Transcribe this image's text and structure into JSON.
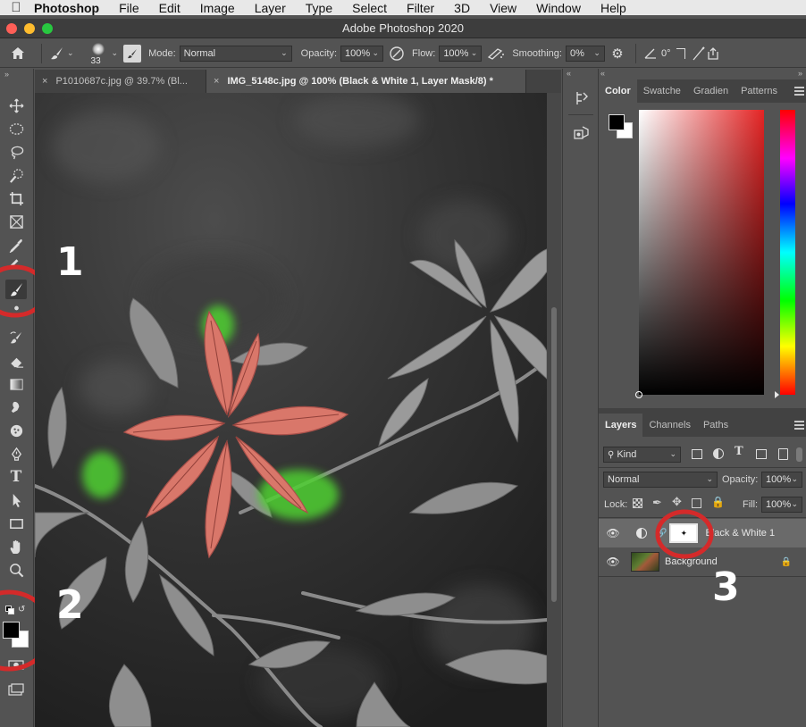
{
  "menubar": {
    "items": [
      "Photoshop",
      "File",
      "Edit",
      "Image",
      "Layer",
      "Type",
      "Select",
      "Filter",
      "3D",
      "View",
      "Window",
      "Help"
    ]
  },
  "window": {
    "title": "Adobe Photoshop 2020"
  },
  "options": {
    "brush_size": "33",
    "mode_label": "Mode:",
    "mode_value": "Normal",
    "opacity_label": "Opacity:",
    "opacity_value": "100%",
    "flow_label": "Flow:",
    "flow_value": "100%",
    "smoothing_label": "Smoothing:",
    "smoothing_value": "0%",
    "angle_value": "0°"
  },
  "tabs": [
    {
      "label": "P1010687c.jpg @ 39.7% (Bl..."
    },
    {
      "label": "IMG_5148c.jpg @ 100% (Black & White 1, Layer Mask/8) *"
    }
  ],
  "color_panel": {
    "tabs": [
      "Color",
      "Swatche",
      "Gradien",
      "Patterns"
    ]
  },
  "layers_panel": {
    "tabs": [
      "Layers",
      "Channels",
      "Paths"
    ],
    "filter_value": "Kind",
    "blend_mode": "Normal",
    "opacity_label": "Opacity:",
    "opacity_value": "100%",
    "lock_label": "Lock:",
    "fill_label": "Fill:",
    "fill_value": "100%",
    "layers": [
      {
        "name": "Black & White 1"
      },
      {
        "name": "Background"
      }
    ]
  },
  "annotations": {
    "n1": "1",
    "n2": "2",
    "n3": "3"
  },
  "colors": {
    "accent_red": "#d42a2a",
    "foreground": "#000000",
    "background": "#ffffff"
  }
}
